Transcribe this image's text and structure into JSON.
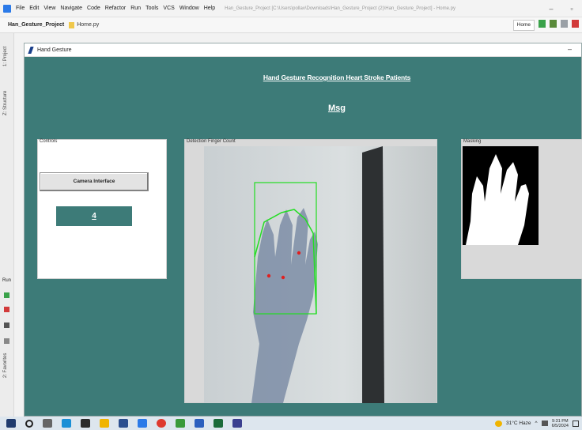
{
  "ide": {
    "menu": [
      "File",
      "Edit",
      "View",
      "Navigate",
      "Code",
      "Refactor",
      "Run",
      "Tools",
      "VCS",
      "Window",
      "Help"
    ],
    "title_path": "Han_Gesture_Project [C:\\Users\\pollav\\Downloads\\Han_Gesture_Project (2)\\Han_Gesture_Project] - Home.py",
    "breadcrumb_project": "Han_Gesture_Project",
    "breadcrumb_file": "Home.py",
    "run_config": "Home",
    "side_labels": [
      "1: Project",
      "Z: Structure",
      "2: Favorites"
    ],
    "run_tab": "Run"
  },
  "window": {
    "title": "Hand Gesture",
    "minimize": "–"
  },
  "app": {
    "heading": "Hand Gesture Recognition Heart Stroke Patients",
    "message": "Msg",
    "controls_label": "Controls",
    "camera_button": "Camera Interface",
    "finger_count": "4",
    "detection_label": "Detection Finger Count",
    "masking_label": "Masking"
  },
  "taskbar": {
    "weather": "31°C Haze",
    "time": "9:31 PM",
    "date": "6/5/2024"
  },
  "colors": {
    "app_bg": "#3d7b78",
    "detect_box": "#22dd22",
    "fingertip_points": "#e02020"
  },
  "icons": [
    "windows-start-icon",
    "search-icon",
    "task-view-icon",
    "edge-icon",
    "store-icon",
    "file-explorer-icon",
    "app-icon",
    "vscode-icon",
    "chrome-icon",
    "app-icon",
    "word-icon",
    "pycharm-icon",
    "tk-feather-icon"
  ]
}
